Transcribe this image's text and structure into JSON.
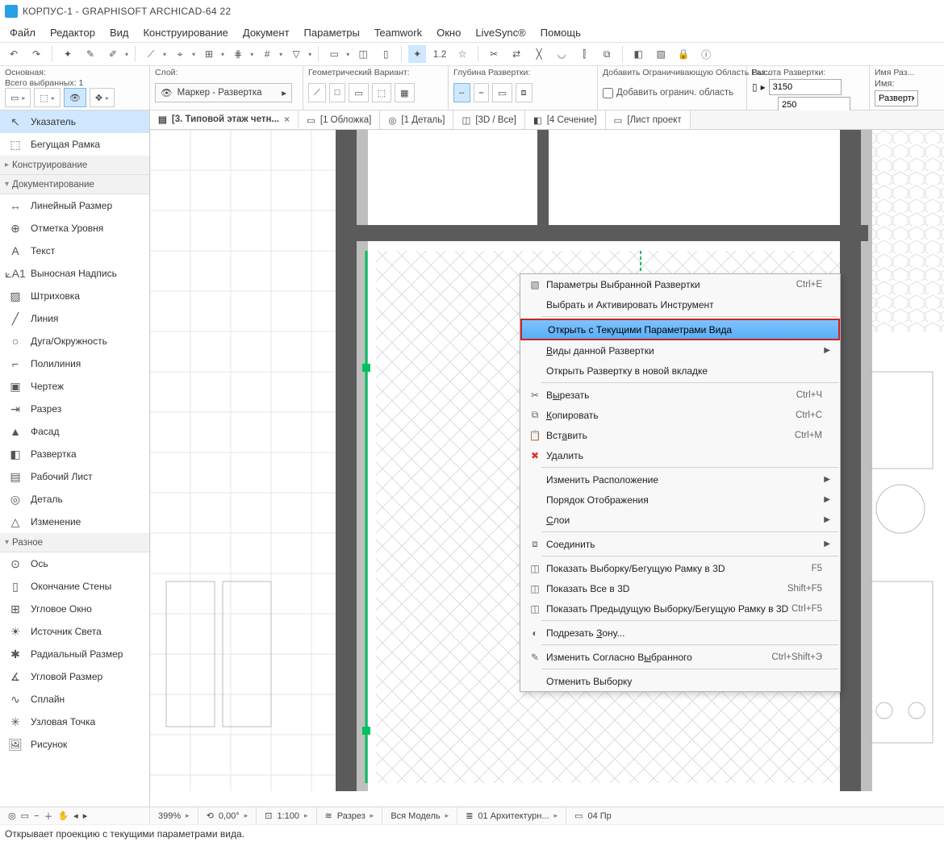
{
  "title": "КОРПУС-1 - GRAPHISOFT ARCHICAD-64 22",
  "menu": [
    "Файл",
    "Редактор",
    "Вид",
    "Конструирование",
    "Документ",
    "Параметры",
    "Teamwork",
    "Окно",
    "LiveSync®",
    "Помощь"
  ],
  "info": {
    "main_label": "Основная:",
    "selected_label": "Всего выбранных: 1",
    "layer_label": "Слой:",
    "layer_value": "Маркер - Развертка",
    "geom_label": "Геометрический Вариант:",
    "depth_label": "Глубина Развертки:",
    "add_bound_label": "Добавить Ограничивающую Область Раз...",
    "add_bound_value": "Добавить огранич. область",
    "height_label": "Высота Развертки:",
    "height_top": "3150",
    "height_bot": "250",
    "name_group_label": "Имя Раз...",
    "name_label": "Имя:",
    "name_value": "Развертк"
  },
  "tabs": [
    {
      "label": "[3. Типовой этаж четн...",
      "active": true,
      "closable": true
    },
    {
      "label": "[1 Обложка]",
      "active": false
    },
    {
      "label": "[1 Деталь]",
      "active": false
    },
    {
      "label": "[3D / Все]",
      "active": false
    },
    {
      "label": "[4 Сечение]",
      "active": false
    },
    {
      "label": "[Лист проект",
      "active": false
    }
  ],
  "toolbox": {
    "pointer": "Указатель",
    "marquee": "Бегущая Рамка",
    "group_design": "Конструирование",
    "group_document": "Документирование",
    "tools_doc": [
      "Линейный Размер",
      "Отметка Уровня",
      "Текст",
      "Выносная Надпись",
      "Штриховка",
      "Линия",
      "Дуга/Окружность",
      "Полилиния",
      "Чертеж",
      "Разрез",
      "Фасад",
      "Развертка",
      "Рабочий Лист",
      "Деталь",
      "Изменение"
    ],
    "group_misc": "Разное",
    "tools_misc": [
      "Ось",
      "Окончание Стены",
      "Угловое Окно",
      "Источник Света",
      "Радиальный Размер",
      "Угловой Размер",
      "Сплайн",
      "Узловая Точка",
      "Рисунок"
    ]
  },
  "context": {
    "i0": {
      "label": "Параметры Выбранной Развертки",
      "sc": "Ctrl+E"
    },
    "i1": {
      "label": "Выбрать и Активировать Инструмент"
    },
    "i2": {
      "label": "Открыть с Текущими Параметрами Вида"
    },
    "i3": {
      "label": "Виды данной Развертки"
    },
    "i4": {
      "label": "Открыть Развертку в новой вкладке"
    },
    "i5": {
      "label": "Вырезать",
      "sc": "Ctrl+Ч"
    },
    "i6": {
      "label": "Копировать",
      "sc": "Ctrl+С"
    },
    "i7": {
      "label": "Вставить",
      "sc": "Ctrl+М"
    },
    "i8": {
      "label": "Удалить"
    },
    "i9": {
      "label": "Изменить Расположение"
    },
    "i10": {
      "label": "Порядок Отображения"
    },
    "i11": {
      "label": "Слои"
    },
    "i12": {
      "label": "Соединить"
    },
    "i13": {
      "label": "Показать Выборку/Бегущую Рамку в 3D",
      "sc": "F5"
    },
    "i14": {
      "label": "Показать Все в 3D",
      "sc": "Shift+F5"
    },
    "i15": {
      "label": "Показать Предыдущую Выборку/Бегущую Рамку в 3D",
      "sc": "Ctrl+F5"
    },
    "i16": {
      "label": "Подрезать Зону..."
    },
    "i17": {
      "label": "Изменить Согласно Выбранного",
      "sc": "Ctrl+Shift+Э"
    },
    "i18": {
      "label": "Отменить Выборку"
    }
  },
  "status": {
    "zoom": "399%",
    "angle": "0,00°",
    "scale": "1:100",
    "filter": "Разрез",
    "model": "Вся Модель",
    "layer_combo": "01 Архитектурн...",
    "sheet": "04 Пр"
  },
  "help": "Открывает проекцию с текущими параметрами вида."
}
